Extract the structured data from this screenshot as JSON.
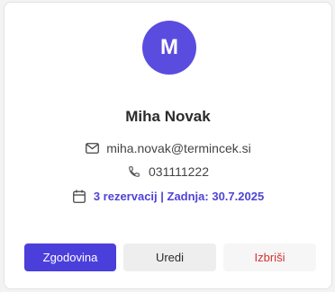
{
  "profile": {
    "initial": "M",
    "name": "Miha Novak",
    "email": "miha.novak@termincek.si",
    "phone": "031111222",
    "reservations": "3 rezervacij | Zadnja: 30.7.2025"
  },
  "actions": {
    "history_label": "Zgodovina",
    "edit_label": "Uredi",
    "delete_label": "Izbriši"
  },
  "colors": {
    "accent": "#4b3fdc",
    "avatar": "#5b4ce0",
    "danger": "#d63333"
  },
  "icons": {
    "email": "mail-icon",
    "phone": "phone-icon",
    "reservations": "calendar-icon"
  }
}
